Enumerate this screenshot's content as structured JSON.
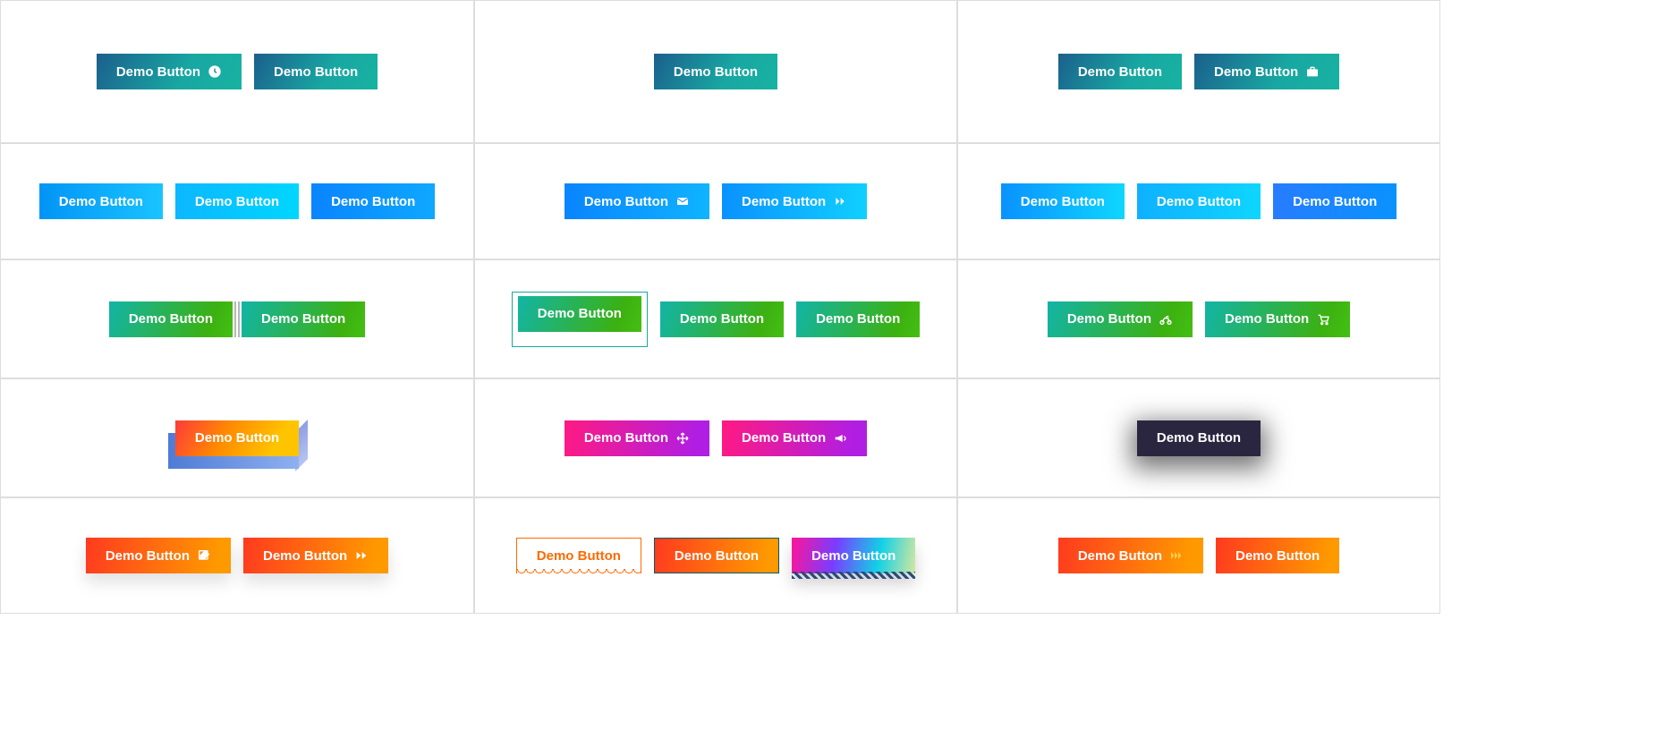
{
  "rows": [
    {
      "cells": [
        {
          "buttons": [
            {
              "label": "Demo Button",
              "icon": "clock"
            },
            {
              "label": "Demo Button"
            }
          ]
        },
        {
          "buttons": [
            {
              "label": "Demo Button"
            }
          ]
        },
        {
          "buttons": [
            {
              "label": "Demo Button"
            },
            {
              "label": "Demo Button",
              "icon": "briefcase"
            }
          ]
        }
      ]
    },
    {
      "cells": [
        {
          "buttons": [
            {
              "label": "Demo Button"
            },
            {
              "label": "Demo Button"
            },
            {
              "label": "Demo Button"
            }
          ]
        },
        {
          "buttons": [
            {
              "label": "Demo Button",
              "icon": "envelope"
            },
            {
              "label": "Demo Button",
              "icon": "double-chevron"
            }
          ]
        },
        {
          "buttons": [
            {
              "label": "Demo Button"
            },
            {
              "label": "Demo Button"
            },
            {
              "label": "Demo Button"
            }
          ]
        }
      ]
    },
    {
      "cells": [
        {
          "buttons": [
            {
              "label": "Demo Button"
            },
            {
              "label": "Demo Button"
            }
          ]
        },
        {
          "buttons": [
            {
              "label": "Demo Button"
            },
            {
              "label": "Demo Button"
            },
            {
              "label": "Demo Button"
            }
          ]
        },
        {
          "buttons": [
            {
              "label": "Demo Button",
              "icon": "motorcycle"
            },
            {
              "label": "Demo Button",
              "icon": "cart"
            }
          ]
        }
      ]
    },
    {
      "cells": [
        {
          "buttons": [
            {
              "label": "Demo Button"
            }
          ]
        },
        {
          "buttons": [
            {
              "label": "Demo Button",
              "icon": "move"
            },
            {
              "label": "Demo Button",
              "icon": "bullhorn"
            }
          ]
        },
        {
          "buttons": [
            {
              "label": "Demo Button"
            }
          ]
        }
      ]
    },
    {
      "cells": [
        {
          "buttons": [
            {
              "label": "Demo Button",
              "icon": "edit"
            },
            {
              "label": "Demo Button",
              "icon": "fast-forward"
            }
          ]
        },
        {
          "buttons": [
            {
              "label": "Demo Button"
            },
            {
              "label": "Demo Button"
            },
            {
              "label": "Demo Button"
            }
          ]
        },
        {
          "buttons": [
            {
              "label": "Demo Button",
              "icon": "triple-chevron"
            },
            {
              "label": "Demo Button"
            }
          ]
        }
      ]
    }
  ]
}
